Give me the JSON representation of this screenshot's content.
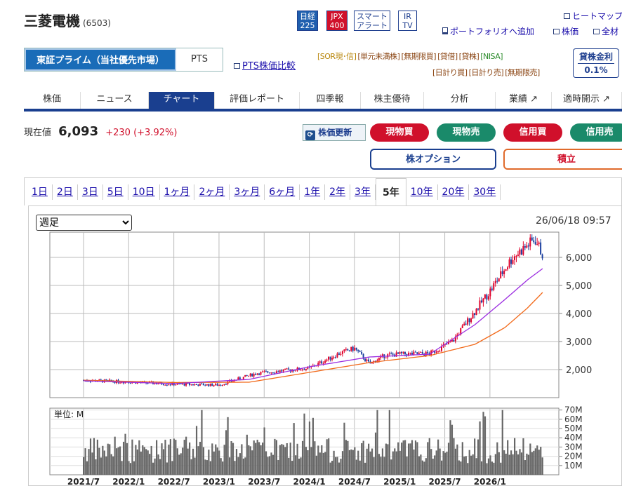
{
  "header": {
    "company_name": "三菱電機",
    "stock_code": "(6503)",
    "index_badges": [
      {
        "label": "日経\n225",
        "bg": "#1f5fae",
        "fg": "#ffffff"
      },
      {
        "label": "JPX\n400",
        "bg": "#d0102b",
        "fg": "#ffffff"
      },
      {
        "label": "スマート\nアラート",
        "bg": "#ffffff",
        "fg": "#1f3f8f"
      },
      {
        "label": "IR\nTV",
        "bg": "#ffffff",
        "fg": "#1f3f8f"
      }
    ],
    "top_links": {
      "heatmap": "ヒートマップ",
      "add_portfolio": "ポートフォリオへ追加",
      "stock_price": "株価",
      "all": "全材"
    }
  },
  "market_tabs": {
    "primary": "東証プライム（当社優先市場）",
    "pts": "PTS"
  },
  "pts_compare_link": "PTS株価比較",
  "trade_flags_row1": [
    "[SOR現･信]",
    "[単元未満株]",
    "[無期限買]",
    "[貸借]",
    "[貸株]",
    "[NISA]"
  ],
  "trade_flags_row2": [
    "[日計り買]",
    "[日計り売]",
    "[無期限売]"
  ],
  "lending": {
    "label": "貸株金利",
    "rate": "0.1%"
  },
  "nav_tabs": [
    {
      "label": "株価",
      "active": false
    },
    {
      "label": "ニュース",
      "active": false
    },
    {
      "label": "チャート",
      "active": true
    },
    {
      "label": "評価レポート",
      "active": false
    },
    {
      "label": "四季報",
      "active": false
    },
    {
      "label": "株主優待",
      "active": false
    },
    {
      "label": "分析",
      "active": false
    },
    {
      "label": "業績 ↗",
      "active": false
    },
    {
      "label": "適時開示 ↗",
      "active": false
    }
  ],
  "price": {
    "label": "現在値",
    "value": "6,093",
    "change": "+230 (+3.92%)"
  },
  "actions": {
    "refresh": "株価更新",
    "buy_cash": "現物買",
    "sell_cash": "現物売",
    "buy_margin": "信用買",
    "sell_margin": "信用売",
    "option": "株オプション",
    "accumulate": "積立"
  },
  "colors": {
    "brand_navy": "#1a3f8f",
    "buy_red": "#d0102b",
    "sell_green": "#1a8a6a",
    "accumulate_orange": "#e06a2b"
  },
  "period_tabs": [
    "1日",
    "2日",
    "3日",
    "5日",
    "10日",
    "1ヶ月",
    "2ヶ月",
    "3ヶ月",
    "6ヶ月",
    "1年",
    "2年",
    "3年",
    "5年",
    "10年",
    "20年",
    "30年"
  ],
  "active_period": "5年",
  "chart": {
    "frequency_selected": "週足",
    "as_of": "26/06/18 09:57",
    "volume_unit": "単位: M"
  },
  "chart_data": {
    "type": "candlestick",
    "x_tick_labels": [
      "2021/7",
      "2022/1",
      "2022/7",
      "2023/1",
      "2023/7",
      "2024/1",
      "2024/7",
      "2025/1",
      "2025/7",
      "2026/1"
    ],
    "price_axis": {
      "ticks": [
        2000,
        3000,
        4000,
        5000,
        6000
      ],
      "tick_labels": [
        "2,000",
        "3,000",
        "4,000",
        "5,000",
        "6,000"
      ],
      "ylim": [
        1000,
        6900
      ]
    },
    "volume_axis": {
      "ticks": [
        10,
        20,
        30,
        40,
        50,
        60,
        70
      ],
      "tick_labels": [
        "10M",
        "20M",
        "30M",
        "40M",
        "50M",
        "60M",
        "70M"
      ],
      "ylim": [
        0,
        72
      ]
    },
    "price_path_months": [
      0,
      6,
      12,
      18,
      23,
      30,
      34,
      36,
      38,
      40,
      42,
      46,
      49,
      54,
      57,
      60,
      61
    ],
    "price_path_values": [
      1620,
      1560,
      1480,
      1450,
      1870,
      2050,
      2580,
      2760,
      2200,
      2500,
      2550,
      2570,
      3000,
      4800,
      6000,
      6650,
      6093
    ],
    "ma_fast_months": [
      0,
      12,
      22,
      30,
      38,
      46,
      52,
      56,
      59,
      61
    ],
    "ma_fast_values": [
      1600,
      1500,
      1650,
      2100,
      2450,
      2550,
      3600,
      4500,
      5200,
      5600
    ],
    "ma_slow_months": [
      0,
      12,
      22,
      30,
      38,
      46,
      52,
      56,
      59,
      61
    ],
    "ma_slow_values": [
      1620,
      1540,
      1550,
      1900,
      2250,
      2500,
      2900,
      3500,
      4200,
      4750
    ],
    "volume_level_m": 25
  }
}
